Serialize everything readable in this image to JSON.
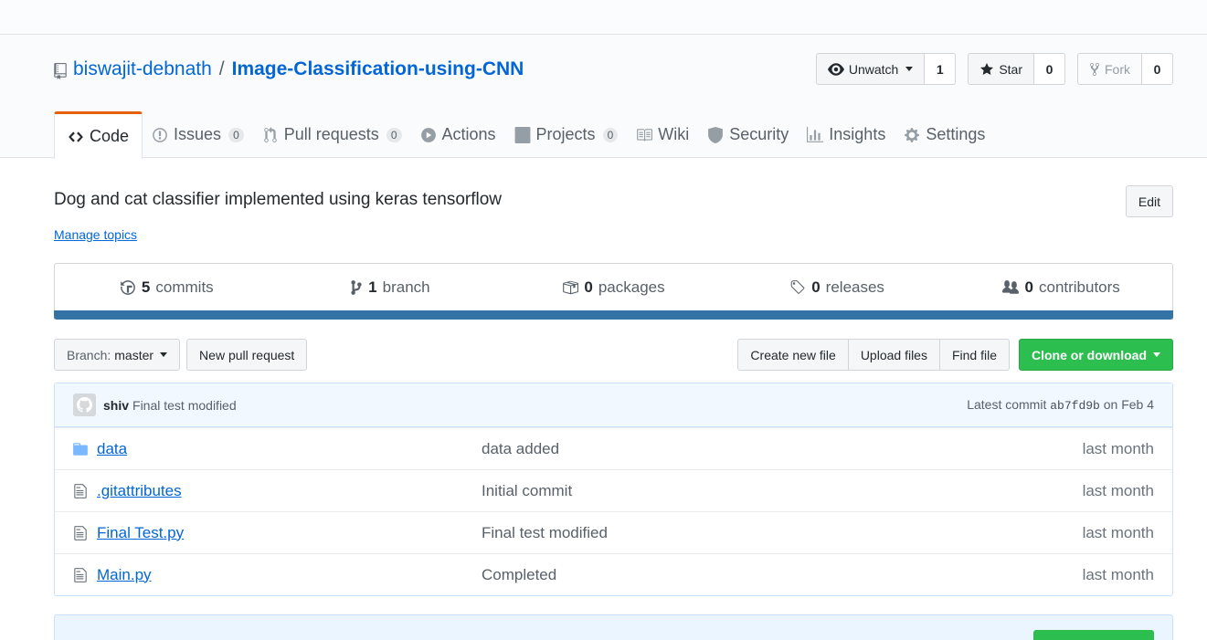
{
  "repo": {
    "owner": "biswajit-debnath",
    "separator": "/",
    "name": "Image-Classification-using-CNN",
    "description": "Dog and cat classifier implemented using keras tensorflow",
    "manage_topics": "Manage topics",
    "edit_label": "Edit"
  },
  "actions": {
    "watch_label": "Unwatch",
    "watch_count": "1",
    "star_label": "Star",
    "star_count": "0",
    "fork_label": "Fork",
    "fork_count": "0"
  },
  "tabs": [
    {
      "label": "Code",
      "counter": null,
      "icon": "code-icon"
    },
    {
      "label": "Issues",
      "counter": "0",
      "icon": "issue-icon"
    },
    {
      "label": "Pull requests",
      "counter": "0",
      "icon": "pull-request-icon"
    },
    {
      "label": "Actions",
      "counter": null,
      "icon": "play-icon"
    },
    {
      "label": "Projects",
      "counter": "0",
      "icon": "project-icon"
    },
    {
      "label": "Wiki",
      "counter": null,
      "icon": "book-icon"
    },
    {
      "label": "Security",
      "counter": null,
      "icon": "shield-icon"
    },
    {
      "label": "Insights",
      "counter": null,
      "icon": "graph-icon"
    },
    {
      "label": "Settings",
      "counter": null,
      "icon": "gear-icon"
    }
  ],
  "summary": {
    "commits_num": "5",
    "commits_label": "commits",
    "branch_num": "1",
    "branch_label": "branch",
    "packages_num": "0",
    "packages_label": "packages",
    "releases_num": "0",
    "releases_label": "releases",
    "contributors_num": "0",
    "contributors_label": "contributors",
    "language_color": "#3572a5"
  },
  "filenav": {
    "branch_prefix": "Branch:",
    "branch_name": "master",
    "new_pr": "New pull request",
    "create_file": "Create new file",
    "upload_files": "Upload files",
    "find_file": "Find file",
    "clone": "Clone or download"
  },
  "commit": {
    "author": "shiv",
    "message": "Final test modified",
    "latest_label": "Latest commit",
    "sha": "ab7fd9b",
    "date": "on Feb 4"
  },
  "files": [
    {
      "name": "data",
      "type": "folder",
      "message": "data added",
      "age": "last month"
    },
    {
      "name": ".gitattributes",
      "type": "file",
      "message": "Initial commit",
      "age": "last month"
    },
    {
      "name": "Final Test.py",
      "type": "file",
      "message": "Final test modified",
      "age": "last month"
    },
    {
      "name": "Main.py",
      "type": "file",
      "message": "Completed",
      "age": "last month"
    }
  ]
}
